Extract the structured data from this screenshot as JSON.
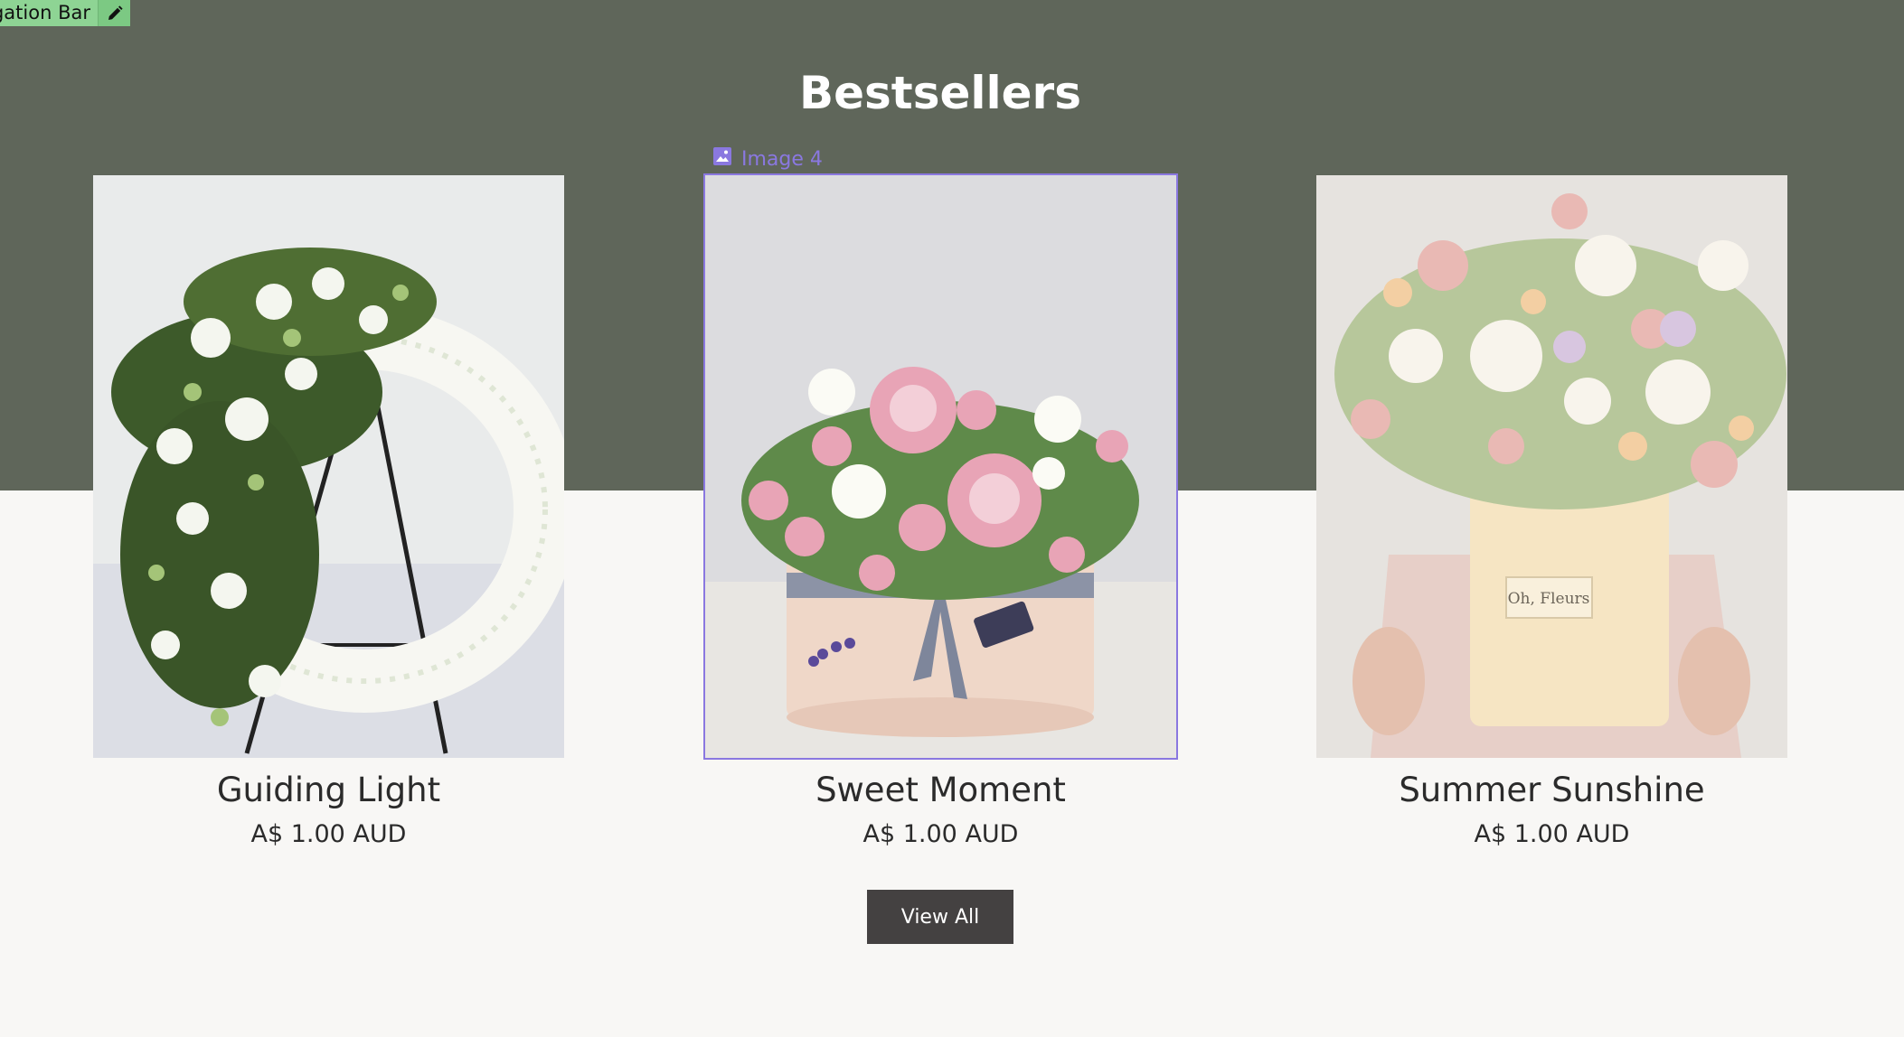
{
  "editor": {
    "tag_label": "Navigation Bar",
    "edit_icon": "pencil-icon",
    "selected_label": "Image 4",
    "selected_icon": "image-icon",
    "selection_color": "#8a78e0"
  },
  "section": {
    "title": "Bestsellers",
    "band_color": "#5f665a",
    "background_color": "#f8f7f5"
  },
  "products": [
    {
      "name": "Guiding Light",
      "price": "A$ 1.00 AUD",
      "image": "white-flower-wreath-on-stand"
    },
    {
      "name": "Sweet Moment",
      "price": "A$ 1.00 AUD",
      "image": "pink-roses-in-hat-box"
    },
    {
      "name": "Summer Sunshine",
      "price": "A$ 1.00 AUD",
      "image": "pastel-bouquet-in-cream-box"
    }
  ],
  "view_all": {
    "label": "View All",
    "color": "#444141"
  }
}
